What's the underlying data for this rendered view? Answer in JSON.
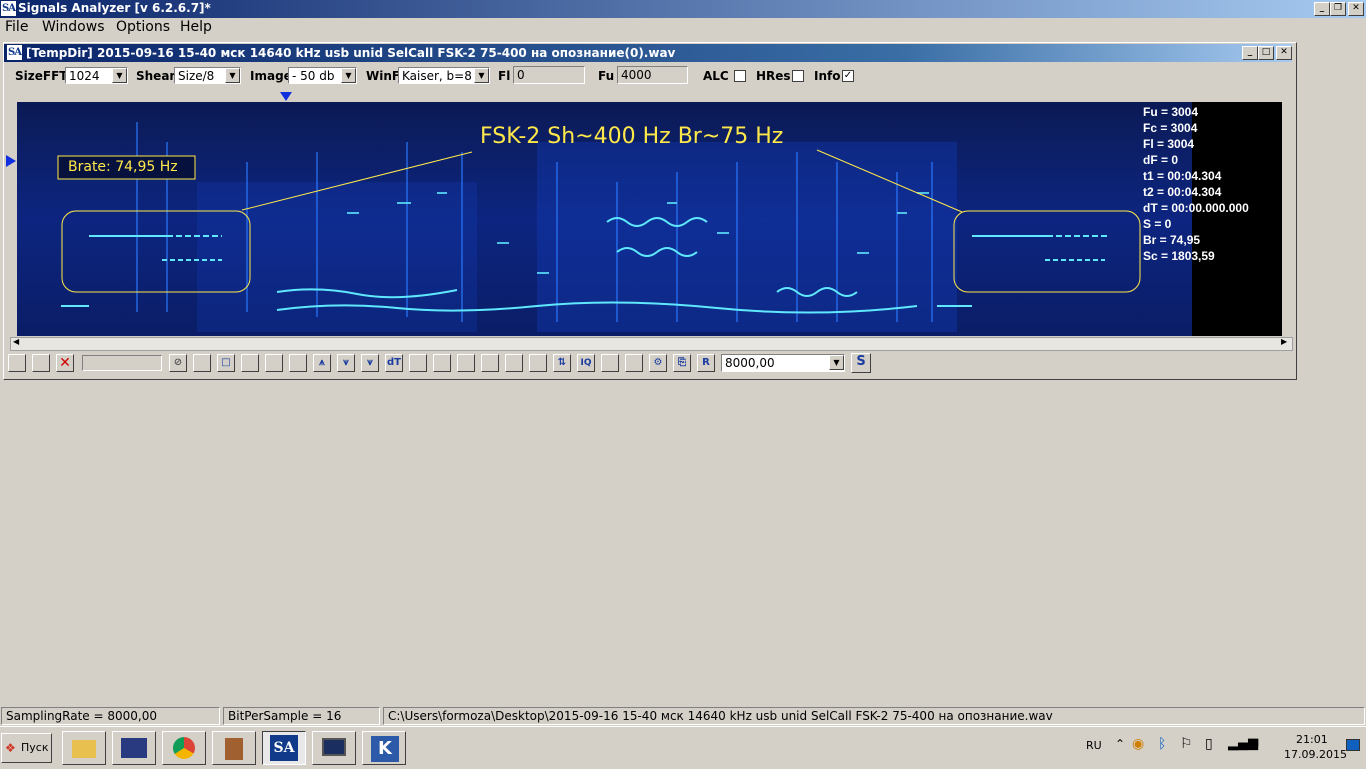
{
  "app": {
    "title": "Signals Analyzer [v 6.2.6.7]*",
    "logo": "SA"
  },
  "menu": {
    "file": "File",
    "windows": "Windows",
    "options": "Options",
    "help": "Help"
  },
  "child": {
    "title": "[TempDir] 2015-09-16 15-40 мск 14640 kHz usb unid SelCall FSK-2 75-400 на опознание(0).wav"
  },
  "options": {
    "sizefft_label": "SizeFFT",
    "sizefft_value": "1024",
    "shear_label": "Shear",
    "shear_value": "Size/8",
    "image_label": "Image",
    "image_value": "- 50 db",
    "winf_label": "WinF",
    "winf_value": "Kaiser, b=8",
    "fl_label": "Fl",
    "fl_value": "0",
    "fu_label": "Fu",
    "fu_value": "4000",
    "alc_label": "ALC",
    "alc_checked": false,
    "hres_label": "HRes",
    "hres_checked": false,
    "info_label": "Info",
    "info_checked": true
  },
  "spectrogram": {
    "annotation": "FSK-2 Sh~400 Hz Br~75 Hz",
    "brate": "Brate: 74,95 Hz",
    "info_lines": [
      "Fu = 3004",
      "Fc = 3004",
      "Fl = 3004",
      "dF = 0",
      "t1 = 00:04.304",
      "t2 = 00:04.304",
      "dT = 00:00.000.000",
      "S = 0",
      "Br = 74,95",
      "Sc = 1803,59"
    ]
  },
  "toolbar": {
    "rate_value": "8000,00",
    "dt_label": "dT",
    "r_label": "R",
    "s_label": "S",
    "iq_label": "IQ"
  },
  "statusbar": {
    "sampling": "SamplingRate = 8000,00",
    "bps": "BitPerSample = 16",
    "path": "C:\\Users\\formoza\\Desktop\\2015-09-16 15-40 мск 14640 kHz usb unid SelCall FSK-2 75-400 на опознание.wav"
  },
  "taskbar": {
    "start": "Пуск",
    "lang": "RU",
    "time": "21:01",
    "date": "17.09.2015"
  },
  "colors": {
    "spectro_bg": "#060b1e",
    "signal": "#37d8ff",
    "annotation": "#ffe94a",
    "titlebar": "#0a246a"
  }
}
